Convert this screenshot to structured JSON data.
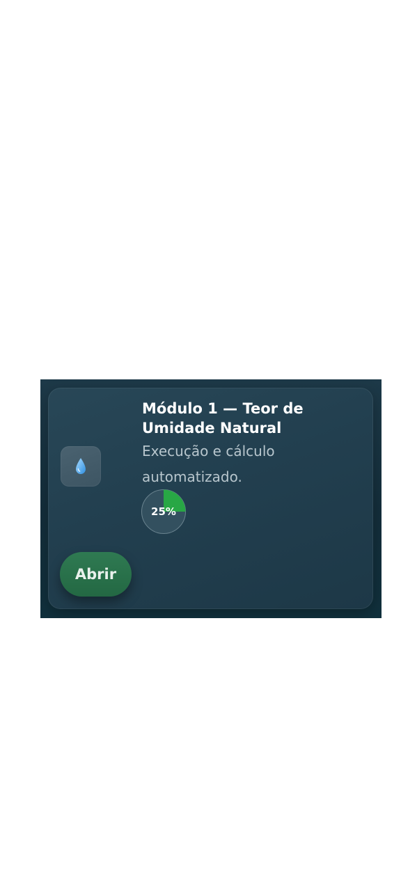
{
  "module_card": {
    "icon": "water-drop-icon",
    "title": "Módulo 1 — Teor de Umidade Natural",
    "subtitle": "Execução e cálculo automatizado.",
    "progress": {
      "percent": 25,
      "label": "25%"
    },
    "open_button_label": "Abrir"
  },
  "colors": {
    "background_outer": "#ffffff",
    "panel": "#1a3544",
    "card": "#244353",
    "icon_tile": "#445c6a",
    "progress_fill": "#28a745",
    "progress_track": "#33505f",
    "button": "#2a7049",
    "title_text": "#ffffff",
    "subtitle_text": "#b8c6cd"
  }
}
